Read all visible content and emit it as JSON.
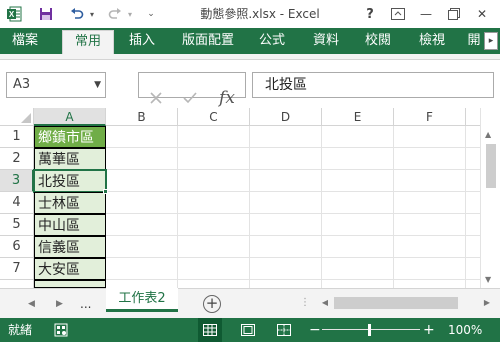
{
  "window": {
    "title": "動態參照.xlsx - Excel",
    "help": "?",
    "minimize": "—",
    "close": "✕"
  },
  "ribbon": {
    "file_tab": "檔案",
    "tabs": [
      "常用",
      "插入",
      "版面配置",
      "公式",
      "資料",
      "校閱",
      "檢視",
      "開"
    ],
    "active_tab": "常用"
  },
  "formula_bar": {
    "name_box": "A3",
    "formula": "北投區",
    "fx_label": "fx"
  },
  "grid": {
    "columns": [
      "A",
      "B",
      "C",
      "D",
      "E",
      "F"
    ],
    "selected_column": "A",
    "rows": [
      "1",
      "2",
      "3",
      "4",
      "5",
      "6",
      "7"
    ],
    "selected_row": "3",
    "cells_A": [
      "鄉鎮市區",
      "萬華區",
      "北投區",
      "士林區",
      "中山區",
      "信義區",
      "大安區"
    ]
  },
  "sheets": {
    "ellipsis": "...",
    "tabs": [
      "工作表2"
    ],
    "active": "工作表2",
    "add": "+"
  },
  "status": {
    "ready": "就緒",
    "zoom": "100%",
    "minus": "−",
    "plus": "+"
  },
  "colors": {
    "accent": "#217346",
    "header_fill": "#70ad47",
    "data_fill": "#e2efda"
  }
}
